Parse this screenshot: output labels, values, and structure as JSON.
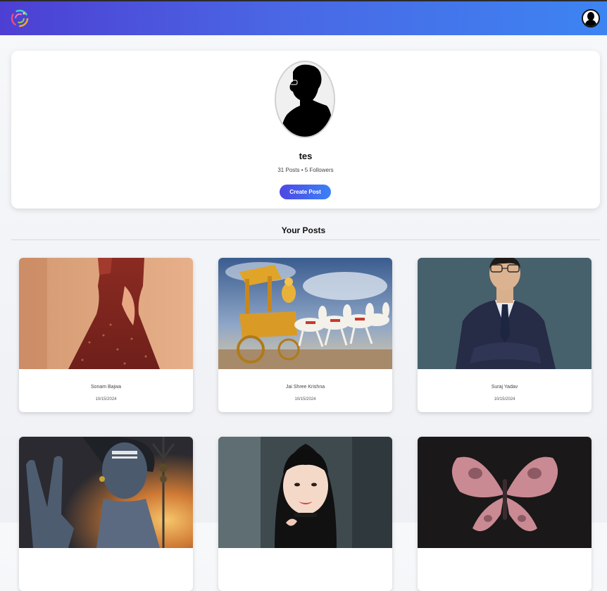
{
  "header": {
    "logo_icon": "colorful-swirl-logo-icon",
    "avatar_icon": "user-silhouette-avatar-icon"
  },
  "profile": {
    "username": "tes",
    "stats": "31 Posts • 5 Followers",
    "create_post_label": "Create Post",
    "picture_icon": "person-silhouette-icon"
  },
  "section": {
    "title": "Your Posts"
  },
  "posts": [
    {
      "title": "Sonam Bajwa",
      "date": "10/15/2024"
    },
    {
      "title": "Jai Shree Krishna",
      "date": "10/15/2024"
    },
    {
      "title": "Suraj Yadav",
      "date": "10/15/2024"
    },
    {
      "title": "",
      "date": ""
    },
    {
      "title": "",
      "date": ""
    },
    {
      "title": "",
      "date": ""
    }
  ],
  "colors": {
    "header_start": "#4d3fd3",
    "header_end": "#3d84f2",
    "button_start": "#4f46e5",
    "button_end": "#3b82f6"
  }
}
